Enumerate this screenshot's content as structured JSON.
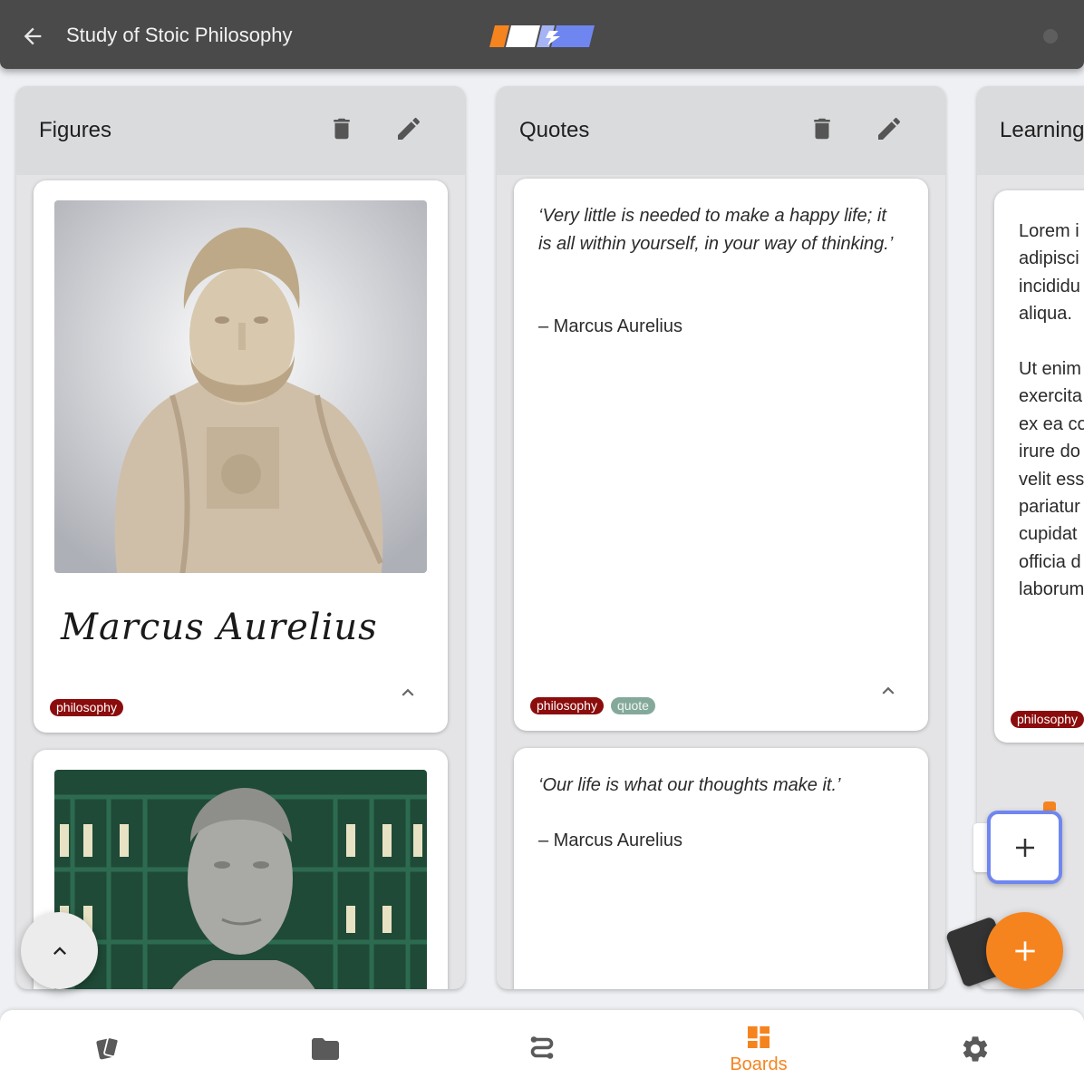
{
  "header": {
    "title": "Study of Stoic Philosophy",
    "logo_colors": [
      "#f5841f",
      "#ffffff",
      "#6f86f1"
    ]
  },
  "columns": [
    {
      "title": "Figures",
      "cards": [
        {
          "signature": "Marcus Aurelius",
          "image": "marble-bust-portrait",
          "tags": [
            "philosophy"
          ]
        },
        {
          "image": "stone-bust-portrait",
          "tags": []
        }
      ]
    },
    {
      "title": "Quotes",
      "cards": [
        {
          "quote": "‘Very little is needed to make a happy life; it is all within yourself, in your way of thinking.’",
          "author": "– Marcus Aurelius",
          "tags": [
            "philosophy",
            "quote"
          ]
        },
        {
          "quote": "‘Our life is what our thoughts make it.’",
          "author": "– Marcus Aurelius",
          "tags": []
        }
      ]
    },
    {
      "title": "Learning",
      "cards": [
        {
          "text_p1": "Lorem i\nadipisci\nincididu\naliqua.",
          "text_p2": "Ut enim\nexercita\nex ea co\nirure do\nvelit ess\npariatur\ncupidat\nofficia d\nlaborum",
          "tags": [
            "philosophy"
          ]
        }
      ]
    }
  ],
  "bottom_nav": {
    "items": [
      {
        "icon": "cards-icon",
        "label": ""
      },
      {
        "icon": "folder-icon",
        "label": ""
      },
      {
        "icon": "route-icon",
        "label": ""
      },
      {
        "icon": "boards-icon",
        "label": "Boards",
        "active": true
      },
      {
        "icon": "settings-icon",
        "label": ""
      }
    ]
  },
  "colors": {
    "accent": "#f5841f",
    "highlight": "#6f86f1",
    "tag_philosophy": "#8b0c0c",
    "tag_quote": "#84a99b",
    "topbar": "#4a4a4a"
  }
}
